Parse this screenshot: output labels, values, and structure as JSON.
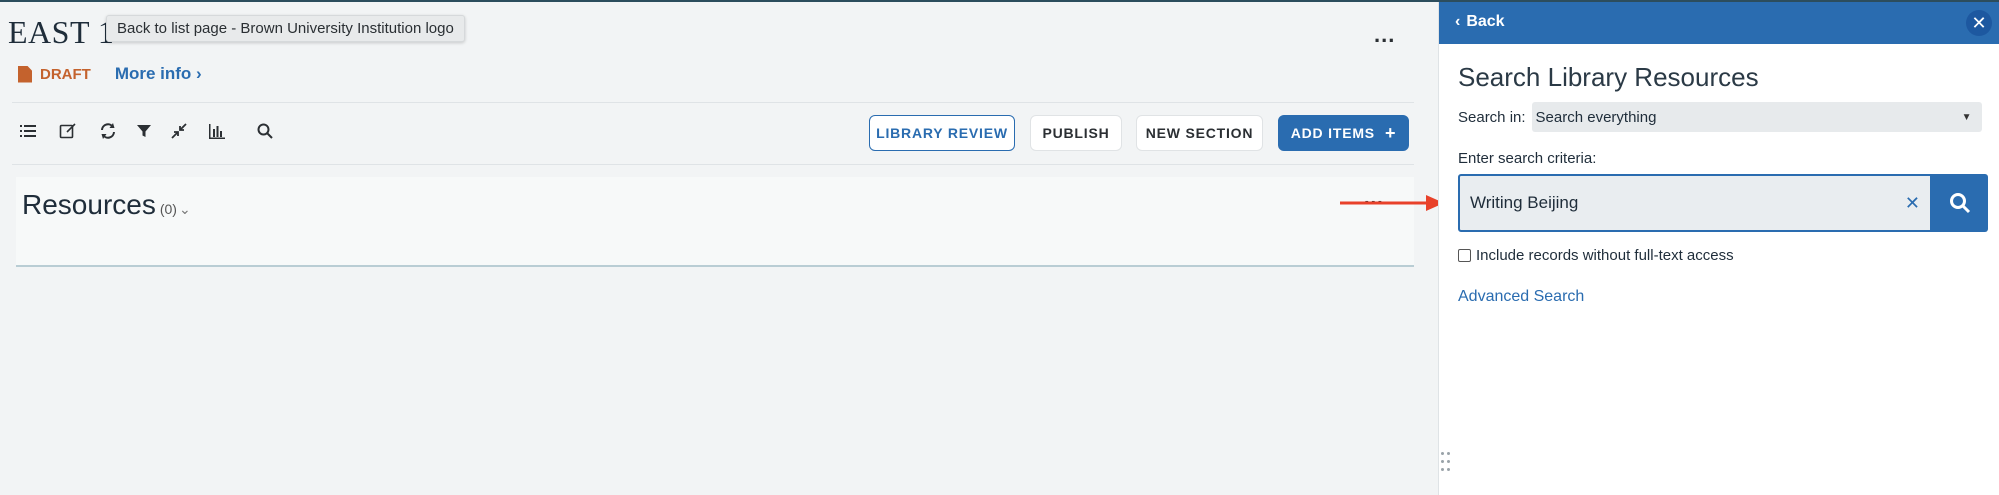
{
  "main": {
    "list_title": "EAST 1",
    "tooltip": "Back to list page - Brown University Institution logo",
    "status": "DRAFT",
    "more_info": "More info ›",
    "toolbar_buttons": {
      "library_review": "LIBRARY REVIEW",
      "publish": "PUBLISH",
      "new_section": "NEW SECTION",
      "add_items": "ADD ITEMS",
      "add_items_icon": "+"
    },
    "section": {
      "title": "Resources",
      "count": "(0)",
      "chevron": "⌄",
      "more": "..."
    },
    "more_top": "..."
  },
  "panel": {
    "back_label": "Back",
    "back_chevron": "‹",
    "close_icon": "✕",
    "title": "Search Library Resources",
    "search_in_label": "Search in:",
    "search_in_value": "Search everything",
    "select_caret": "▼",
    "criteria_label": "Enter search criteria:",
    "search_value": "Writing Beijing",
    "clear_icon": "✕",
    "include_label": "Include records without full-text access",
    "include_checked": false,
    "advanced_search": "Advanced Search"
  },
  "colors": {
    "accent": "#2a6cb0",
    "draft": "#c4622d",
    "annotation_arrow": "#e8412a"
  }
}
